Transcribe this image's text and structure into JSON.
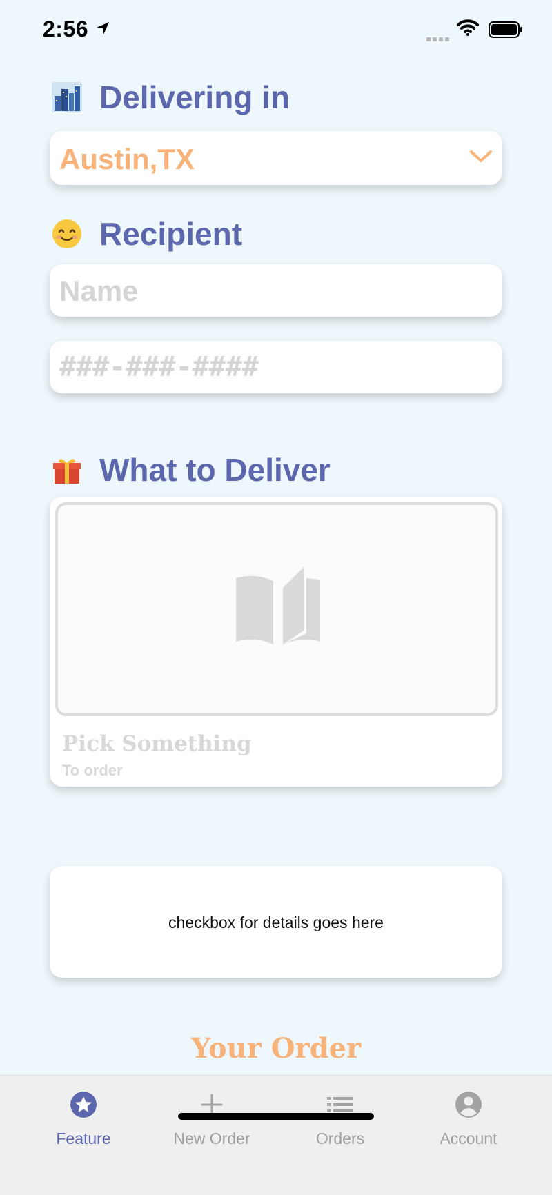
{
  "status_bar": {
    "time": "2:56"
  },
  "delivering": {
    "title": "Delivering in",
    "emoji": "city-icon",
    "city": "Austin,TX"
  },
  "recipient": {
    "title": "Recipient",
    "emoji": "smile-icon",
    "name_placeholder": "Name",
    "phone_placeholder": "###-###-####"
  },
  "what_to_deliver": {
    "title": "What to Deliver",
    "emoji": "gift-icon",
    "pick_title": "Pick Something",
    "pick_subtitle": "To order"
  },
  "details": {
    "text": "checkbox for details goes here"
  },
  "your_order": {
    "title": "Your Order"
  },
  "tab_bar": {
    "items": [
      {
        "label": "Feature",
        "icon": "star-icon",
        "active": true
      },
      {
        "label": "New Order",
        "icon": "plus-icon",
        "active": false
      },
      {
        "label": "Orders",
        "icon": "list-icon",
        "active": false
      },
      {
        "label": "Account",
        "icon": "account-icon",
        "active": false
      }
    ]
  },
  "colors": {
    "accent": "#5d67ad",
    "orange": "#f7b37a",
    "background": "#eef7fb",
    "placeholder": "#d5d5d5"
  }
}
